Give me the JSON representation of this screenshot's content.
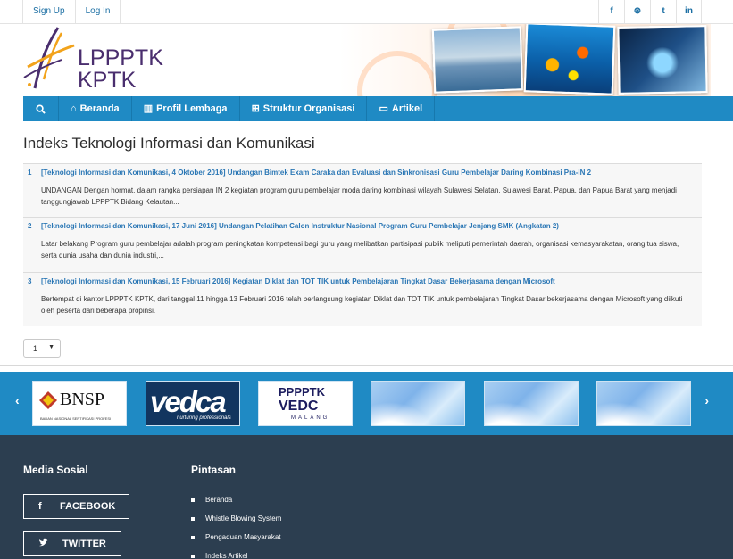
{
  "topbar": {
    "signup": "Sign Up",
    "login": "Log In",
    "social": [
      "f",
      "⊛",
      "t",
      "in"
    ]
  },
  "header": {
    "logo_line1": "LPPPTK",
    "logo_line2": "KPTK"
  },
  "nav": {
    "items": [
      {
        "icon": "home-icon",
        "label": "Beranda"
      },
      {
        "icon": "institution-icon",
        "label": "Profil Lembaga"
      },
      {
        "icon": "sitemap-icon",
        "label": "Struktur Organisasi"
      },
      {
        "icon": "folder-open-icon",
        "label": "Artikel"
      }
    ]
  },
  "main": {
    "title": "Indeks Teknologi Informasi dan Komunikasi",
    "articles": [
      {
        "num": "1",
        "title": "[Teknologi Informasi dan Komunikasi, 4 Oktober 2016] Undangan Bimtek Exam Caraka dan Evaluasi dan Sinkronisasi Guru Pembelajar Daring Kombinasi Pra-IN 2",
        "desc": "UNDANGAN Dengan hormat, dalam rangka persiapan IN 2 kegiatan program guru pembelajar moda daring kombinasi wilayah Sulawesi Selatan, Sulawesi Barat, Papua, dan Papua Barat yang menjadi tanggungjawab LPPPTK Bidang Kelautan..."
      },
      {
        "num": "2",
        "title": "[Teknologi Informasi dan Komunikasi, 17 Juni 2016] Undangan Pelatihan Calon Instruktur Nasional Program Guru Pembelajar Jenjang SMK (Angkatan 2)",
        "desc": "Latar belakang Program guru pembelajar adalah program peningkatan kompetensi bagi guru yang melibatkan partisipasi publik meliputi pemerintah daerah, organisasi kemasyarakatan, orang tua siswa, serta dunia usaha dan dunia industri,..."
      },
      {
        "num": "3",
        "title": "[Teknologi Informasi dan Komunikasi, 15 Februari 2016] Kegiatan Diklat dan TOT TIK untuk Pembelajaran Tingkat Dasar Bekerjasama dengan Microsoft",
        "desc": "Bertempat di kantor LPPPTK KPTK, dari tanggal 11 hingga 13 Februari 2016 telah berlangsung kegiatan Diklat dan TOT TIK untuk pembelajaran Tingkat Dasar bekerjasama dengan Microsoft yang diikuti oleh peserta dari beberapa propinsi."
      }
    ],
    "pager_value": "1"
  },
  "partners": {
    "bnsp": "BNSP",
    "bnsp_sub": "BADAN NASIONAL SERTIFIKASI PROFESI",
    "vedca": "vedca",
    "vedca_sub": "nurturing professionals",
    "pppptk_top": "PPPPTK",
    "pppptk_mid": "VEDC",
    "pppptk_bot": "MALANG"
  },
  "footer": {
    "media_heading": "Media Sosial",
    "pintasan_heading": "Pintasan",
    "facebook": "FACEBOOK",
    "twitter": "TWITTER",
    "links": [
      "Beranda",
      "Whistle Blowing System",
      "Pengaduan Masyarakat",
      "Indeks Artikel"
    ]
  },
  "colors": {
    "nav": "#1f8ac4",
    "footer": "#2c3e50",
    "link": "#2b77b5"
  }
}
